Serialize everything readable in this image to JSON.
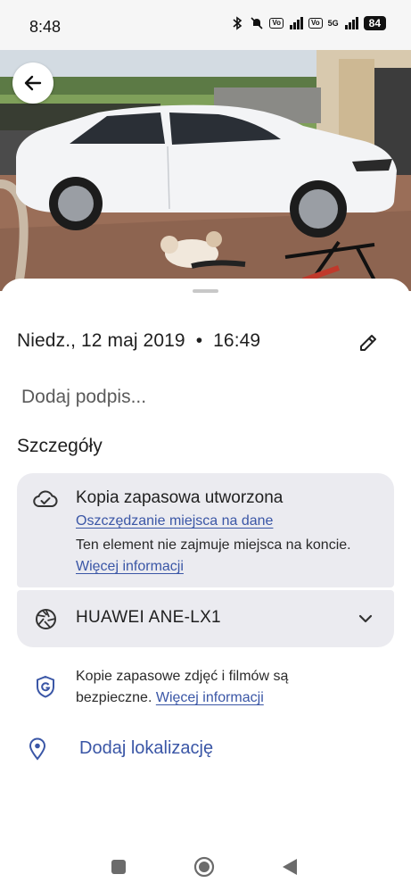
{
  "status_bar": {
    "time": "8:48",
    "battery": "84",
    "network": "5G",
    "volte_label": "Vo LTE"
  },
  "photo": {
    "description_icons": [
      "car-photo"
    ],
    "back_icon": "arrow-left-icon"
  },
  "sheet": {
    "date": "Niedz., 12 maj 2019",
    "separator": "•",
    "time": "16:49",
    "edit_icon": "pencil-icon",
    "caption_placeholder": "Dodaj podpis...",
    "details_title": "Szczegóły",
    "backup": {
      "icon": "cloud-done-icon",
      "title": "Kopia zapasowa utworzona",
      "link": "Oszczędzanie miejsca na dane",
      "desc": "Ten element nie zajmuje miejsca na koncie.",
      "more_link": "Więcej informacji"
    },
    "device": {
      "icon": "camera-aperture-icon",
      "name": "HUAWEI ANE-LX1",
      "expand_icon": "chevron-down-icon"
    },
    "safe": {
      "icon": "google-shield-icon",
      "text": "Kopie zapasowe zdjęć i filmów są bezpieczne.",
      "more_link": "Więcej informacji"
    },
    "location": {
      "icon": "location-pin-icon",
      "label": "Dodaj lokalizację"
    }
  },
  "navbar": {
    "recents_icon": "square-icon",
    "home_icon": "circle-home-icon",
    "back_icon": "triangle-back-icon"
  },
  "colors": {
    "link": "#3a56a6",
    "card_bg": "#ebebf0",
    "text": "#1f1f1f"
  }
}
